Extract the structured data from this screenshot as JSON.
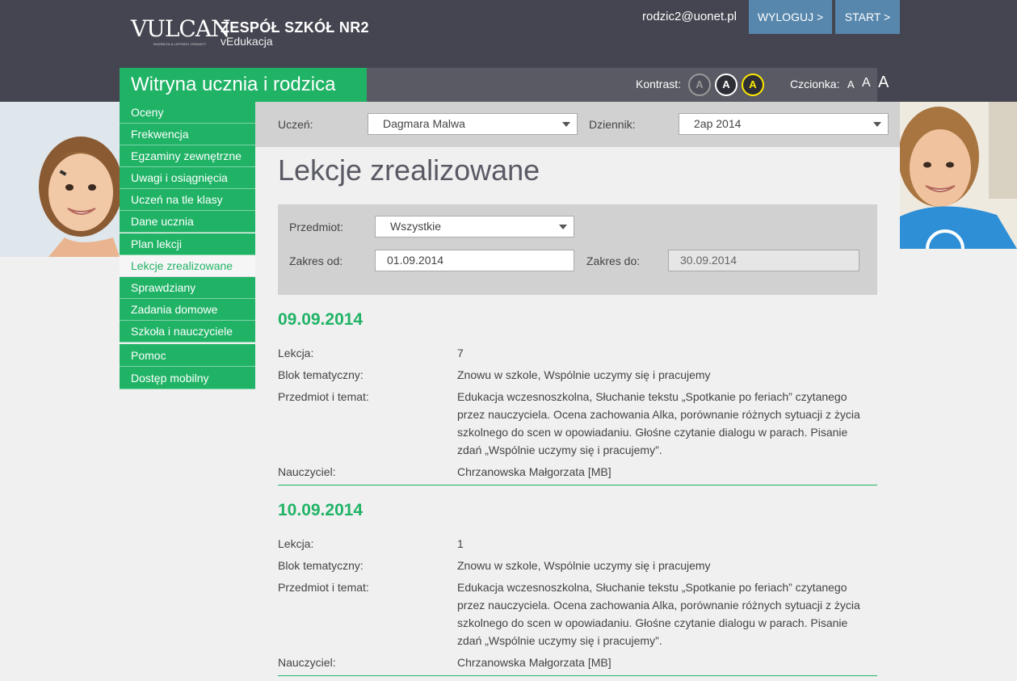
{
  "header": {
    "logo_text": "VULCAN",
    "logo_tagline": "RAZEM DLA LEPSZEJ OŚWIATY",
    "school_name": "ZESPÓŁ SZKÓŁ NR2",
    "school_sub": "vEdukacja",
    "user_email": "rodzic2@uonet.pl",
    "logout_label": "WYLOGUJ >",
    "start_label": "START >",
    "portal_title": "Witryna ucznia i rodzica",
    "contrast_label": "Kontrast:",
    "contrast_options": [
      "A",
      "A",
      "A"
    ],
    "font_label": "Czcionka:",
    "font_options": [
      "A",
      "A",
      "A"
    ]
  },
  "sidebar": {
    "items": [
      {
        "label": "Oceny"
      },
      {
        "label": "Frekwencja"
      },
      {
        "label": "Egzaminy zewnętrzne"
      },
      {
        "label": "Uwagi i osiągnięcia"
      },
      {
        "label": "Uczeń na tle klasy"
      },
      {
        "label": "Dane ucznia"
      },
      {
        "label": "Plan lekcji"
      },
      {
        "label": "Lekcje zrealizowane"
      },
      {
        "label": "Sprawdziany"
      },
      {
        "label": "Zadania domowe"
      },
      {
        "label": "Szkoła i nauczyciele"
      },
      {
        "label": "Pomoc"
      },
      {
        "label": "Dostęp mobilny"
      }
    ],
    "active_index": 7
  },
  "selectors": {
    "student_label": "Uczeń:",
    "student_value": "Dagmara Malwa",
    "journal_label": "Dziennik:",
    "journal_value": "2ap 2014"
  },
  "page_title": "Lekcje zrealizowane",
  "filter": {
    "subject_label": "Przedmiot:",
    "subject_value": "Wszystkie",
    "from_label": "Zakres od:",
    "from_value": "01.09.2014",
    "to_label": "Zakres do:",
    "to_value": "30.09.2014"
  },
  "lessons": [
    {
      "date": "09.09.2014",
      "lesson_label": "Lekcja:",
      "lesson_value": "7",
      "block_label": "Blok tematyczny:",
      "block_value": "Znowu w szkole, Wspólnie uczymy się i pracujemy",
      "topic_label": "Przedmiot i temat:",
      "topic_value": "Edukacja wczesnoszkolna, Słuchanie tekstu „Spotkanie po feriach” czytanego przez nauczyciela. Ocena zachowania Alka, porównanie różnych sytuacji z życia szkolnego do scen w opowiadaniu. Głośne czytanie dialogu w parach. Pisanie zdań „Wspólnie uczymy się i pracujemy”.",
      "teacher_label": "Nauczyciel:",
      "teacher_value": "Chrzanowska Małgorzata [MB]"
    },
    {
      "date": "10.09.2014",
      "lesson_label": "Lekcja:",
      "lesson_value": "1",
      "block_label": "Blok tematyczny:",
      "block_value": "Znowu w szkole, Wspólnie uczymy się i pracujemy",
      "topic_label": "Przedmiot i temat:",
      "topic_value": "Edukacja wczesnoszkolna, Słuchanie tekstu „Spotkanie po feriach” czytanego przez nauczyciela. Ocena zachowania Alka, porównanie różnych sytuacji z życia szkolnego do scen w opowiadaniu. Głośne czytanie dialogu w parach. Pisanie zdań „Wspólnie uczymy się i pracujemy”.",
      "teacher_label": "Nauczyciel:",
      "teacher_value": "Chrzanowska Małgorzata [MB]"
    }
  ],
  "colors": {
    "accent_green": "#20b366",
    "header_bg": "#444550",
    "button_blue": "#5787ad",
    "panel_gray": "#d1d1d1"
  }
}
